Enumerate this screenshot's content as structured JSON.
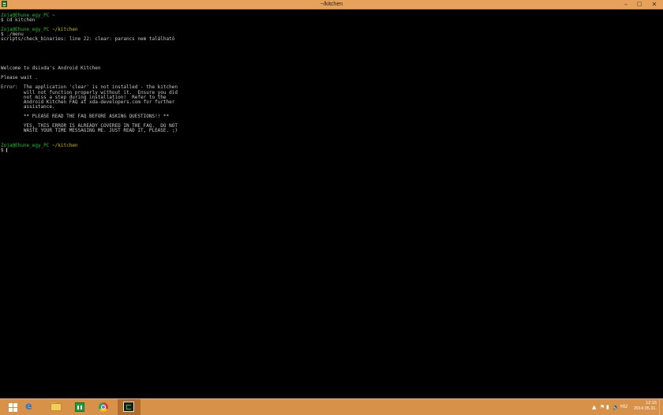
{
  "window": {
    "title": "~/kitchen",
    "controls": {
      "minimize": "–",
      "maximize": "□",
      "close": "✕"
    }
  },
  "terminal": {
    "lines": [
      {
        "text": "Zoja@Ehune_egy_PC ~",
        "color": "green"
      },
      {
        "text": "$ cd kitchen",
        "color": "default"
      },
      {
        "text": "",
        "color": "default"
      },
      {
        "text": "Zoja@Ehune_egy_PC ~/kitchen",
        "color": "green"
      },
      {
        "text": "$ ./menu",
        "color": "default"
      },
      {
        "text": "scripts/check_binaries: line 22: clear: parancs nem található",
        "color": "default"
      },
      {
        "text": "",
        "color": "default"
      },
      {
        "text": "",
        "color": "default"
      },
      {
        "text": "",
        "color": "default"
      },
      {
        "text": "",
        "color": "default"
      },
      {
        "text": "",
        "color": "default"
      },
      {
        "text": "Welcome to dsixda's Android Kitchen",
        "color": "default"
      },
      {
        "text": "",
        "color": "default"
      },
      {
        "text": "Please wait .",
        "color": "default"
      },
      {
        "text": "",
        "color": "default"
      },
      {
        "text": "Error:  The application 'clear' is not installed - the kitchen",
        "color": "default"
      },
      {
        "text": "        will not function properly without it.  Ensure you did",
        "color": "default"
      },
      {
        "text": "        not miss a step during installation!  Refer to the",
        "color": "default"
      },
      {
        "text": "        Android Kitchen FAQ at xda-developers.com for further",
        "color": "default"
      },
      {
        "text": "        assistance.",
        "color": "default"
      },
      {
        "text": "",
        "color": "default"
      },
      {
        "text": "        ** PLEASE READ THE FAQ BEFORE ASKING QUESTIONS!! **",
        "color": "default"
      },
      {
        "text": "",
        "color": "default"
      },
      {
        "text": "        YES, THIS ERROR IS ALREADY COVERED IN THE FAQ.  DO NOT",
        "color": "default"
      },
      {
        "text": "        WASTE YOUR TIME MESSAGING ME. JUST READ IT, PLEASE. ;)",
        "color": "default"
      },
      {
        "text": "",
        "color": "default"
      },
      {
        "text": "",
        "color": "default"
      },
      {
        "text": "Zoja@Ehune_egy_PC ~/kitchen",
        "color": "green"
      },
      {
        "text": "$ ",
        "color": "default",
        "cursor": true
      }
    ]
  },
  "taskbar": {
    "apps": [
      {
        "name": "internet-explorer-icon"
      },
      {
        "name": "file-explorer-icon"
      },
      {
        "name": "store-icon"
      },
      {
        "name": "chrome-icon"
      },
      {
        "name": "terminal-icon",
        "active": true
      }
    ],
    "tray": {
      "chevron": "▲",
      "flag": "⚑",
      "network": "▮",
      "volume": "🔈",
      "language": "HU",
      "time": "12:15",
      "date": "2014.05.31."
    }
  },
  "colors": {
    "titlebar": "#e6a15a",
    "taskbar": "#d89149",
    "terminal_bg": "#000000",
    "prompt_green": "#21c121",
    "text": "#c8c8c8"
  }
}
